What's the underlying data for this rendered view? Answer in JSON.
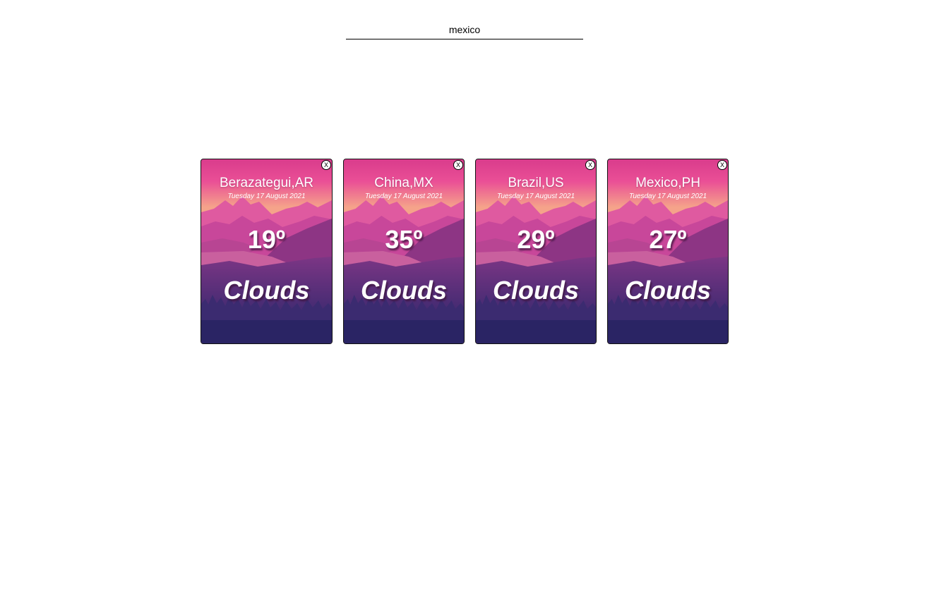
{
  "search": {
    "value": "mexico",
    "placeholder": ""
  },
  "cards": [
    {
      "city": "Berazategui,AR",
      "date": "Tuesday 17 August 2021",
      "temp": "19º",
      "condition": "Clouds",
      "close_label": "X"
    },
    {
      "city": "China,MX",
      "date": "Tuesday 17 August 2021",
      "temp": "35º",
      "condition": "Clouds",
      "close_label": "X"
    },
    {
      "city": "Brazil,US",
      "date": "Tuesday 17 August 2021",
      "temp": "29º",
      "condition": "Clouds",
      "close_label": "X"
    },
    {
      "city": "Mexico,PH",
      "date": "Tuesday 17 August 2021",
      "temp": "27º",
      "condition": "Clouds",
      "close_label": "X"
    }
  ],
  "colors": {
    "sky_top": "#e4428f",
    "sky_horizon": "#f4a58a",
    "mountain_far": "#d9569b",
    "mountain_mid": "#b2428c",
    "mountain_near": "#8e3683",
    "lake": "#c45b9c",
    "forest": "#3a2a6e",
    "ground": "#2a2464"
  }
}
